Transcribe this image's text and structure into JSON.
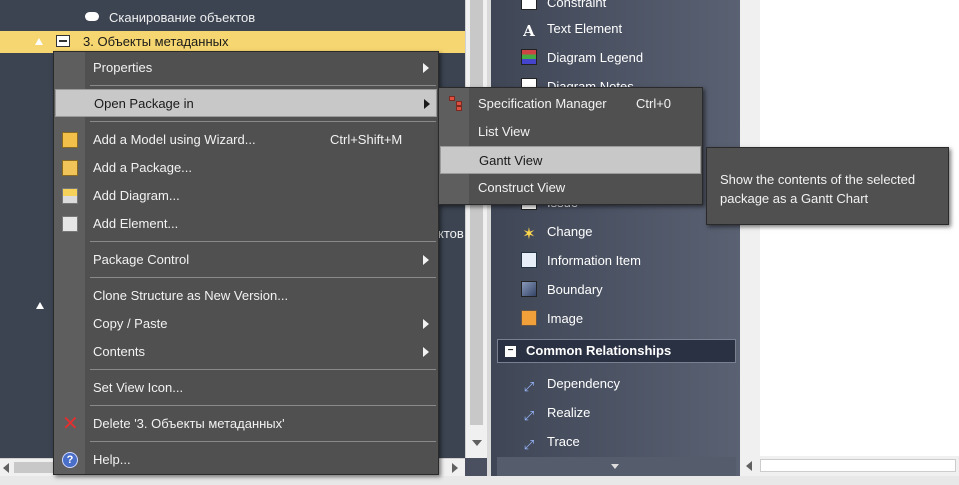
{
  "project_browser": {
    "row_scan_label": "Сканирование объектов",
    "selected_row_label": "3. Объекты метаданных",
    "partial_text": "ктов"
  },
  "toolbox": {
    "items_top": [
      {
        "label": "Constraint",
        "icon": "constraint-icon"
      },
      {
        "label": "Text Element",
        "icon": "text-element-icon"
      },
      {
        "label": "Diagram Legend",
        "icon": "diagram-legend-icon"
      },
      {
        "label": "Diagram Notes",
        "icon": "diagram-notes-icon"
      }
    ],
    "items_mid": [
      {
        "label": "Issue",
        "icon": "issue-icon"
      },
      {
        "label": "Change",
        "icon": "change-icon"
      },
      {
        "label": "Information Item",
        "icon": "information-item-icon"
      },
      {
        "label": "Boundary",
        "icon": "boundary-icon"
      },
      {
        "label": "Image",
        "icon": "image-icon"
      }
    ],
    "section_header": "Common Relationships",
    "relationships": [
      {
        "label": "Dependency",
        "icon": "dependency-icon"
      },
      {
        "label": "Realize",
        "icon": "realize-icon"
      },
      {
        "label": "Trace",
        "icon": "trace-icon"
      }
    ]
  },
  "context_menu": {
    "properties": "Properties",
    "open_package_in": "Open Package in",
    "add_model_wizard": "Add a Model using Wizard...",
    "add_model_wizard_shortcut": "Ctrl+Shift+M",
    "add_package": "Add a Package...",
    "add_diagram": "Add Diagram...",
    "add_element": "Add Element...",
    "package_control": "Package Control",
    "clone_structure": "Clone Structure as New Version...",
    "copy_paste": "Copy / Paste",
    "contents": "Contents",
    "set_view_icon": "Set View Icon...",
    "delete": "Delete '3. Объекты метаданных'",
    "help": "Help..."
  },
  "submenu": {
    "specification_manager": "Specification Manager",
    "specification_manager_shortcut": "Ctrl+0",
    "list_view": "List View",
    "gantt_view": "Gantt View",
    "construct_view": "Construct View"
  },
  "tooltip": {
    "text": "Show the contents of the selected package as a Gantt Chart"
  }
}
